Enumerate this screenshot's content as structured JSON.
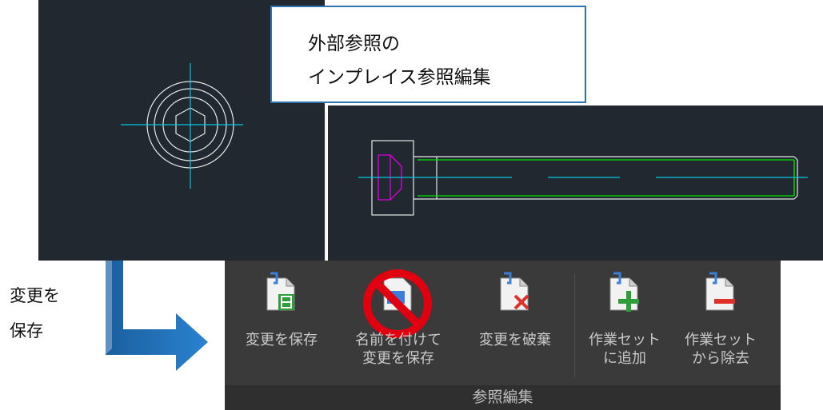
{
  "callout": {
    "line1": "外部参照の",
    "line2": "インプレイス参照編集"
  },
  "side_label": {
    "line1": "変更を",
    "line2": "保存"
  },
  "ribbon": {
    "buttons": [
      {
        "name": "save-changes",
        "label_lines": [
          "変更を保存"
        ],
        "icon": "doc-save-icon"
      },
      {
        "name": "save-changes-as",
        "label_lines": [
          "名前を付けて",
          "変更を保存"
        ],
        "icon": "doc-save-as-icon",
        "disabled_overlay": "prohibited-icon"
      },
      {
        "name": "discard-changes",
        "label_lines": [
          "変更を破棄"
        ],
        "icon": "doc-discard-icon"
      },
      {
        "name": "add-to-working-set",
        "label_lines": [
          "作業セット",
          "に追加"
        ],
        "icon": "doc-add-icon"
      },
      {
        "name": "remove-from-working-set",
        "label_lines": [
          "作業セット",
          "から除去"
        ],
        "icon": "doc-remove-icon"
      }
    ],
    "panel_title": "参照編集"
  },
  "colors": {
    "cad_background": "#212830",
    "centerline": "#00c8e0",
    "outline": "#ffffff",
    "thread": "#00e600",
    "socket": "#e000e0",
    "callout_border": "#2e74b5",
    "arrow": "#1f6fb5",
    "ribbon_background": "#3a3a3a"
  }
}
